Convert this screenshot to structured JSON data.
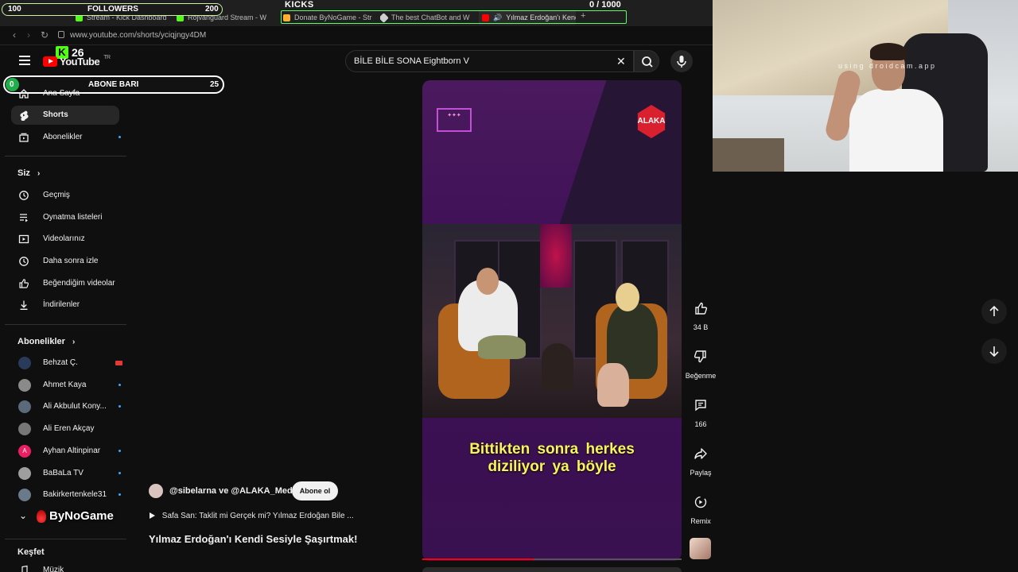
{
  "browser": {
    "tabs": [
      {
        "label": "Stream - Kick Dashboard",
        "color": "#53fc18"
      },
      {
        "label": "Rojvanguard Stream - W",
        "color": "#53fc18"
      },
      {
        "label": "Donate ByNoGame - Stre",
        "color": "#ffb02e"
      },
      {
        "label": "The best ChatBot and W",
        "color": "#cfcfcf"
      },
      {
        "label": "Yılmaz Erdoğan'ı Kend",
        "color": "#ff0000"
      }
    ],
    "url": "www.youtube.com/shorts/yciqjngy4DM"
  },
  "overlay": {
    "followers_label": "FOLLOWERS",
    "followers_min": "100",
    "followers_max": "200",
    "followers_progress_pct": 0,
    "kicks_label": "KICKS",
    "kicks_count": "0 / 1000",
    "kick_badge_count": "26",
    "abone_label": "ABONE BARI",
    "abone_min": "0",
    "abone_max": "25",
    "abone_progress_pct": 0,
    "brand": "ByNoGame",
    "cam_watermark": "using droidcam.app"
  },
  "youtube": {
    "logo_text": "YouTube",
    "region": "TR",
    "search_value": "BİLE BİLE SONA Eightborn V"
  },
  "sidebar": {
    "main": [
      {
        "label": "Ana Sayfa",
        "icon": "home-icon"
      },
      {
        "label": "Shorts",
        "icon": "shorts-icon",
        "active": true
      },
      {
        "label": "Abonelikler",
        "icon": "subscriptions-icon",
        "dot": true
      }
    ],
    "you_header": "Siz",
    "you": [
      {
        "label": "Geçmiş",
        "icon": "history-icon"
      },
      {
        "label": "Oynatma listeleri",
        "icon": "playlists-icon"
      },
      {
        "label": "Videolarınız",
        "icon": "your-videos-icon"
      },
      {
        "label": "Daha sonra izle",
        "icon": "watch-later-icon"
      },
      {
        "label": "Beğendiğim videolar",
        "icon": "liked-videos-icon"
      },
      {
        "label": "İndirilenler",
        "icon": "downloads-icon"
      }
    ],
    "subs_header": "Abonelikler",
    "subs": [
      {
        "label": "Behzat Ç.",
        "avatar_color": "#2a3a5a",
        "live": true
      },
      {
        "label": "Ahmet Kaya",
        "avatar_color": "#8a8a8a",
        "dot": true
      },
      {
        "label": "Ali Akbulut Kony...",
        "avatar_color": "#5a6a7a",
        "dot": true
      },
      {
        "label": "Ali Eren Akçay",
        "avatar_color": "#777777"
      },
      {
        "label": "Ayhan Altinpinar",
        "avatar_color": "#e91e63",
        "initial": "A",
        "dot": true
      },
      {
        "label": "BaBaLa TV",
        "avatar_color": "#9e9e9e",
        "dot": true
      },
      {
        "label": "Bakirkertenkele31",
        "avatar_color": "#6b7a8a",
        "dot": true
      }
    ],
    "explore_header": "Keşfet",
    "explore": [
      {
        "label": "Müzik",
        "icon": "music-icon"
      }
    ]
  },
  "short": {
    "channels": "@sibelarna ve @ALAKA_Media",
    "subscribe_label": "Abone ol",
    "related_text": "Safa San: Taklit mi Gerçek mi? Yılmaz Erdoğan Bile ...",
    "title": "Yılmaz Erdoğan'ı Kendi Sesiyle Şaşırtmak!",
    "subtitle_line1": "Bittikten sonra herkes",
    "subtitle_line2": "diziliyor ya böyle",
    "channel_logo_text": "ALAKA",
    "progress_pct": 43,
    "actions": {
      "like_count": "34 B",
      "dislike_label": "Beğenme",
      "comments_count": "166",
      "share_label": "Paylaş",
      "remix_label": "Remix"
    }
  },
  "colors": {
    "accent": "#ff0000",
    "kick_green": "#53fc18",
    "subtitle_yellow": "#f7f55a",
    "bg": "#0f0f0f"
  }
}
